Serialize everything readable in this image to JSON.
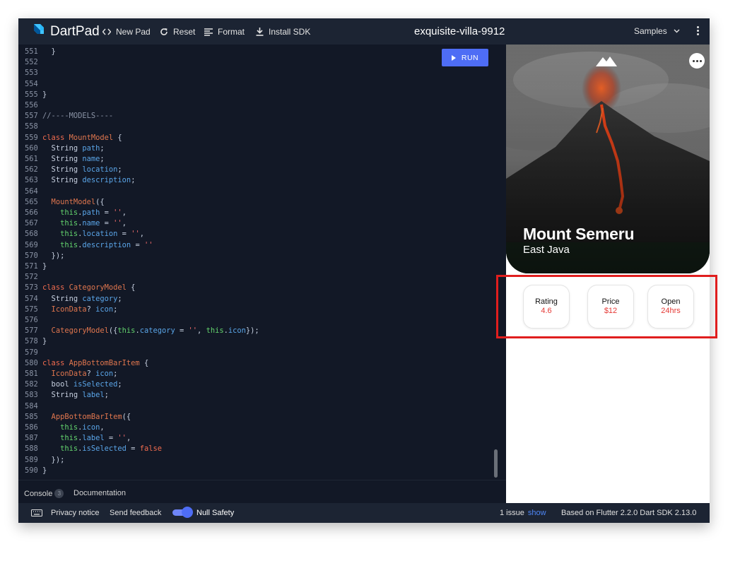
{
  "app": {
    "name": "DartPad",
    "pad_title": "exquisite-villa-9912"
  },
  "toolbar": {
    "new_pad": "New Pad",
    "reset": "Reset",
    "format": "Format",
    "install_sdk": "Install SDK",
    "samples": "Samples"
  },
  "editor": {
    "run_label": "RUN",
    "lines": [
      {
        "n": "551",
        "tokens": [
          {
            "t": "  }",
            "c": ""
          }
        ]
      },
      {
        "n": "552",
        "tokens": []
      },
      {
        "n": "553",
        "tokens": []
      },
      {
        "n": "554",
        "tokens": []
      },
      {
        "n": "555",
        "tokens": [
          {
            "t": "}",
            "c": ""
          }
        ]
      },
      {
        "n": "556",
        "tokens": []
      },
      {
        "n": "557",
        "tokens": [
          {
            "t": "//----MODELS----",
            "c": "cm"
          }
        ]
      },
      {
        "n": "558",
        "tokens": []
      },
      {
        "n": "559",
        "tokens": [
          {
            "t": "class ",
            "c": "k"
          },
          {
            "t": "MountModel",
            "c": "c"
          },
          {
            "t": " {",
            "c": ""
          }
        ]
      },
      {
        "n": "560",
        "tokens": [
          {
            "t": "  String ",
            "c": ""
          },
          {
            "t": "path",
            "c": "f"
          },
          {
            "t": ";",
            "c": ""
          }
        ]
      },
      {
        "n": "561",
        "tokens": [
          {
            "t": "  String ",
            "c": ""
          },
          {
            "t": "name",
            "c": "f"
          },
          {
            "t": ";",
            "c": ""
          }
        ]
      },
      {
        "n": "562",
        "tokens": [
          {
            "t": "  String ",
            "c": ""
          },
          {
            "t": "location",
            "c": "f"
          },
          {
            "t": ";",
            "c": ""
          }
        ]
      },
      {
        "n": "563",
        "tokens": [
          {
            "t": "  String ",
            "c": ""
          },
          {
            "t": "description",
            "c": "f"
          },
          {
            "t": ";",
            "c": ""
          }
        ]
      },
      {
        "n": "564",
        "tokens": []
      },
      {
        "n": "565",
        "tokens": [
          {
            "t": "  MountModel",
            "c": "c"
          },
          {
            "t": "({",
            "c": ""
          }
        ]
      },
      {
        "n": "566",
        "tokens": [
          {
            "t": "    this",
            "c": "t"
          },
          {
            "t": ".",
            "c": ""
          },
          {
            "t": "path",
            "c": "f"
          },
          {
            "t": " = ",
            "c": ""
          },
          {
            "t": "''",
            "c": "s"
          },
          {
            "t": ",",
            "c": ""
          }
        ]
      },
      {
        "n": "567",
        "tokens": [
          {
            "t": "    this",
            "c": "t"
          },
          {
            "t": ".",
            "c": ""
          },
          {
            "t": "name",
            "c": "f"
          },
          {
            "t": " = ",
            "c": ""
          },
          {
            "t": "''",
            "c": "s"
          },
          {
            "t": ",",
            "c": ""
          }
        ]
      },
      {
        "n": "568",
        "tokens": [
          {
            "t": "    this",
            "c": "t"
          },
          {
            "t": ".",
            "c": ""
          },
          {
            "t": "location",
            "c": "f"
          },
          {
            "t": " = ",
            "c": ""
          },
          {
            "t": "''",
            "c": "s"
          },
          {
            "t": ",",
            "c": ""
          }
        ]
      },
      {
        "n": "569",
        "tokens": [
          {
            "t": "    this",
            "c": "t"
          },
          {
            "t": ".",
            "c": ""
          },
          {
            "t": "description",
            "c": "f"
          },
          {
            "t": " = ",
            "c": ""
          },
          {
            "t": "''",
            "c": "s"
          }
        ]
      },
      {
        "n": "570",
        "tokens": [
          {
            "t": "  });",
            "c": ""
          }
        ]
      },
      {
        "n": "571",
        "tokens": [
          {
            "t": "}",
            "c": ""
          }
        ]
      },
      {
        "n": "572",
        "tokens": []
      },
      {
        "n": "573",
        "tokens": [
          {
            "t": "class ",
            "c": "k"
          },
          {
            "t": "CategoryModel",
            "c": "c"
          },
          {
            "t": " {",
            "c": ""
          }
        ]
      },
      {
        "n": "574",
        "tokens": [
          {
            "t": "  String ",
            "c": ""
          },
          {
            "t": "category",
            "c": "f"
          },
          {
            "t": ";",
            "c": ""
          }
        ]
      },
      {
        "n": "575",
        "tokens": [
          {
            "t": "  IconData",
            "c": "c"
          },
          {
            "t": "? ",
            "c": ""
          },
          {
            "t": "icon",
            "c": "f"
          },
          {
            "t": ";",
            "c": ""
          }
        ]
      },
      {
        "n": "576",
        "tokens": []
      },
      {
        "n": "577",
        "tokens": [
          {
            "t": "  CategoryModel",
            "c": "c"
          },
          {
            "t": "({",
            "c": ""
          },
          {
            "t": "this",
            "c": "t"
          },
          {
            "t": ".",
            "c": ""
          },
          {
            "t": "category",
            "c": "f"
          },
          {
            "t": " = ",
            "c": ""
          },
          {
            "t": "''",
            "c": "s"
          },
          {
            "t": ", ",
            "c": ""
          },
          {
            "t": "this",
            "c": "t"
          },
          {
            "t": ".",
            "c": ""
          },
          {
            "t": "icon",
            "c": "f"
          },
          {
            "t": "});",
            "c": ""
          }
        ]
      },
      {
        "n": "578",
        "tokens": [
          {
            "t": "}",
            "c": ""
          }
        ]
      },
      {
        "n": "579",
        "tokens": []
      },
      {
        "n": "580",
        "tokens": [
          {
            "t": "class ",
            "c": "k"
          },
          {
            "t": "AppBottomBarItem",
            "c": "c"
          },
          {
            "t": " {",
            "c": ""
          }
        ]
      },
      {
        "n": "581",
        "tokens": [
          {
            "t": "  IconData",
            "c": "c"
          },
          {
            "t": "? ",
            "c": ""
          },
          {
            "t": "icon",
            "c": "f"
          },
          {
            "t": ";",
            "c": ""
          }
        ]
      },
      {
        "n": "582",
        "tokens": [
          {
            "t": "  bool ",
            "c": ""
          },
          {
            "t": "isSelected",
            "c": "f"
          },
          {
            "t": ";",
            "c": ""
          }
        ]
      },
      {
        "n": "583",
        "tokens": [
          {
            "t": "  String ",
            "c": ""
          },
          {
            "t": "label",
            "c": "f"
          },
          {
            "t": ";",
            "c": ""
          }
        ]
      },
      {
        "n": "584",
        "tokens": []
      },
      {
        "n": "585",
        "tokens": [
          {
            "t": "  AppBottomBarItem",
            "c": "c"
          },
          {
            "t": "({",
            "c": ""
          }
        ]
      },
      {
        "n": "586",
        "tokens": [
          {
            "t": "    this",
            "c": "t"
          },
          {
            "t": ".",
            "c": ""
          },
          {
            "t": "icon",
            "c": "f"
          },
          {
            "t": ",",
            "c": ""
          }
        ]
      },
      {
        "n": "587",
        "tokens": [
          {
            "t": "    this",
            "c": "t"
          },
          {
            "t": ".",
            "c": ""
          },
          {
            "t": "label",
            "c": "f"
          },
          {
            "t": " = ",
            "c": ""
          },
          {
            "t": "''",
            "c": "s"
          },
          {
            "t": ",",
            "c": ""
          }
        ]
      },
      {
        "n": "588",
        "tokens": [
          {
            "t": "    this",
            "c": "t"
          },
          {
            "t": ".",
            "c": ""
          },
          {
            "t": "isSelected",
            "c": "f"
          },
          {
            "t": " = ",
            "c": ""
          },
          {
            "t": "false",
            "c": "k"
          }
        ]
      },
      {
        "n": "589",
        "tokens": [
          {
            "t": "  });",
            "c": ""
          }
        ]
      },
      {
        "n": "590",
        "tokens": [
          {
            "t": "}",
            "c": ""
          }
        ]
      }
    ]
  },
  "bottom_tabs": {
    "console": "Console",
    "console_count": "3",
    "documentation": "Documentation"
  },
  "statusbar": {
    "privacy": "Privacy notice",
    "feedback": "Send feedback",
    "null_safety": "Null Safety",
    "issues": "1 issue",
    "show": "show",
    "version": "Based on Flutter 2.2.0 Dart SDK 2.13.0"
  },
  "preview": {
    "title": "Mount Semeru",
    "subtitle": "East Java",
    "stats": [
      {
        "label": "Rating",
        "value": "4.6"
      },
      {
        "label": "Price",
        "value": "$12"
      },
      {
        "label": "Open",
        "value": "24hrs"
      }
    ]
  },
  "colors": {
    "accent": "#4e6df5",
    "highlight": "#e01e1e",
    "stat_value": "#e53935",
    "editor_bg": "#121826",
    "toolbar_bg": "#1c2433"
  }
}
